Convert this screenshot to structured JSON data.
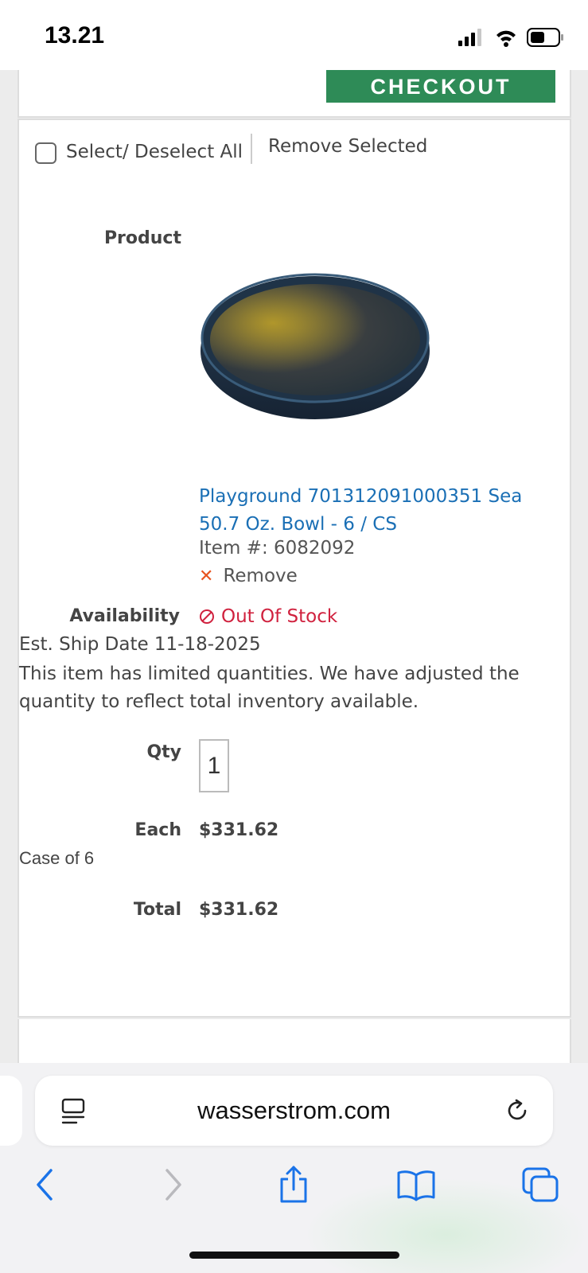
{
  "status_bar": {
    "time": "13.21",
    "icons": [
      "signal-icon",
      "wifi-icon",
      "battery-icon"
    ]
  },
  "header": {
    "checkout_label": "CHECKOUT"
  },
  "cart": {
    "select_all_label": "Select/ Deselect All",
    "remove_selected_label": "Remove Selected",
    "product_label": "Product",
    "product_name": "Playground 701312091000351 Sea 50.7 Oz. Bowl - 6 / CS",
    "item_number": "Item #: 6082092",
    "remove_label": "Remove",
    "availability_label": "Availability",
    "availability_value": "Out Of Stock",
    "ship_date": "Est. Ship Date 11-18-2025",
    "limited_notice": "This item has limited quantities. We have adjusted the quantity to reflect total inventory available.",
    "qty_label": "Qty",
    "qty_value": "1",
    "each_label": "Each",
    "each_price": "$331.62",
    "case_label": "Case of 6",
    "total_label": "Total",
    "total_price": "$331.62"
  },
  "browser": {
    "url": "wasserstrom.com",
    "toolbar_icons": [
      "back-icon",
      "forward-icon",
      "share-icon",
      "bookmarks-icon",
      "tabs-icon"
    ]
  },
  "colors": {
    "accent_green": "#2e8b57",
    "link_blue": "#1a6fb5",
    "out_of_stock_red": "#d0213e",
    "remove_x_orange": "#e8531e"
  }
}
